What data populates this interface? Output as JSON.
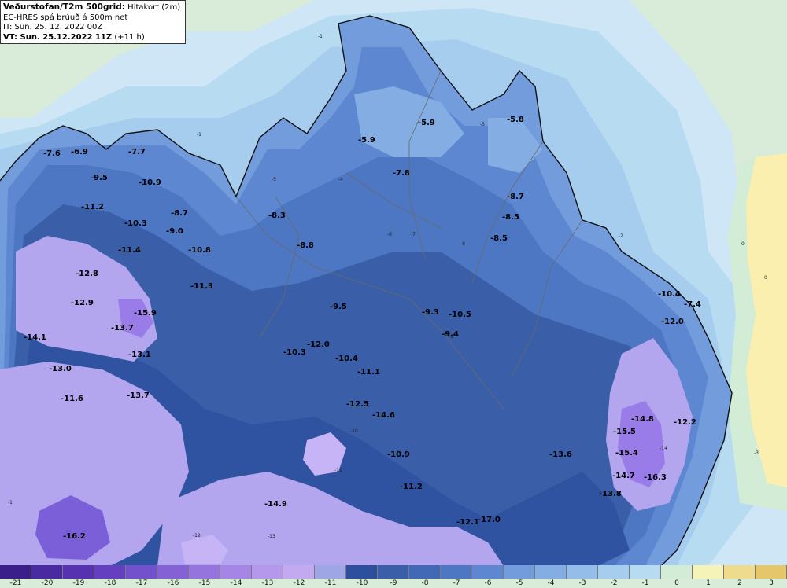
{
  "header": {
    "title_main": "Veðurstofan/T2m 500grid:",
    "title_sub": "Hitakort (2m)",
    "line2": "EC-HRES spá brúuð á 500m net",
    "line3": "IT: Sun. 25. 12. 2022 00Z",
    "line4_main": "VT: Sun. 25.12.2022 11Z",
    "line4_sub": "(+11 h)"
  },
  "colors": {
    "land_outside": "#d9ebd9",
    "sea_warm": "#fbefb0",
    "c_-1": "#b7dcf2",
    "c_-2": "#a6cdee",
    "c_-3": "#95bde9",
    "c_-4": "#84ade3",
    "c_-5": "#729cdb",
    "c_-6": "#5d87d0",
    "c_-7": "#4d77c3",
    "c_-8": "#4169b5",
    "c_-9": "#3a5fa8",
    "c_-10": "#2f53a0",
    "c_-11": "#8f8edc",
    "c_-13": "#b3a6ef",
    "c_-15": "#c7b4f7",
    "c_-16": "#9a7ce8",
    "c_-17": "#7b5fd9"
  },
  "legend": {
    "ticks": [
      "-21",
      "-20",
      "-19",
      "-18",
      "-17",
      "-16",
      "-15",
      "-14",
      "-13",
      "-12",
      "-11",
      "-10",
      "-9",
      "-8",
      "-7",
      "-6",
      "-5",
      "-4",
      "-3",
      "-2",
      "-1",
      "0",
      "1",
      "2",
      "3"
    ],
    "colors": [
      "#3a1f8a",
      "#4a2aa0",
      "#5632b0",
      "#6440c0",
      "#7350cc",
      "#8462d6",
      "#9574de",
      "#a586e6",
      "#b598ec",
      "#c3aaf0",
      "#9fa6e6",
      "#2e4f9e",
      "#3a5fa8",
      "#4169b5",
      "#4d77c3",
      "#5d87d0",
      "#729cdb",
      "#84ade3",
      "#95bde9",
      "#a6cdee",
      "#b7dcf2",
      "#d3ecd6",
      "#f6f3b8",
      "#eedc8c",
      "#e6c66a"
    ]
  },
  "map": {
    "station_values": [
      {
        "label": "-7.6"
      },
      {
        "label": "-6.9"
      },
      {
        "label": "-9.5"
      },
      {
        "label": "-7.7"
      },
      {
        "label": "-10.9"
      },
      {
        "label": "-11.2"
      },
      {
        "label": "-8.7"
      },
      {
        "label": "-10.3"
      },
      {
        "label": "-9.0"
      },
      {
        "label": "-11.4"
      },
      {
        "label": "-10.8"
      },
      {
        "label": "-12.8"
      },
      {
        "label": "-11.3"
      },
      {
        "label": "-12.9"
      },
      {
        "label": "-15.9"
      },
      {
        "label": "-13.7"
      },
      {
        "label": "-14.1"
      },
      {
        "label": "-13.1"
      },
      {
        "label": "-13.0"
      },
      {
        "label": "-13.7"
      },
      {
        "label": "-11.6"
      },
      {
        "label": "-5.9"
      },
      {
        "label": "-5.8"
      },
      {
        "label": "-5.9"
      },
      {
        "label": "-7.8"
      },
      {
        "label": "-8.3"
      },
      {
        "label": "-8.7"
      },
      {
        "label": "-8.5"
      },
      {
        "label": "-8.5"
      },
      {
        "label": "-8.8"
      },
      {
        "label": "-9.5"
      },
      {
        "label": "-9.3"
      },
      {
        "label": "-10.5"
      },
      {
        "label": "-9.4"
      },
      {
        "label": "-12.0"
      },
      {
        "label": "-10.3"
      },
      {
        "label": "-10.4"
      },
      {
        "label": "-11.1"
      },
      {
        "label": "-12.5"
      },
      {
        "label": "-14.6"
      },
      {
        "label": "-10.9"
      },
      {
        "label": "-11.2"
      },
      {
        "label": "-13.6"
      },
      {
        "label": "-12.1"
      },
      {
        "label": "-17.0"
      },
      {
        "label": "-10.4"
      },
      {
        "label": "-7.4"
      },
      {
        "label": "-12.0"
      },
      {
        "label": "-14.8"
      },
      {
        "label": "-12.2"
      },
      {
        "label": "-15.5"
      },
      {
        "label": "-15.4"
      },
      {
        "label": "-14.7"
      },
      {
        "label": "-16.3"
      },
      {
        "label": "-13.8"
      },
      {
        "label": "-14.9"
      },
      {
        "label": "-16.2"
      }
    ],
    "contour_labels": [
      "-1",
      "-2",
      "-3",
      "-4",
      "-5",
      "-6",
      "-7",
      "-8",
      "-9",
      "-10",
      "-11",
      "-12",
      "-13",
      "-14",
      "0"
    ]
  }
}
